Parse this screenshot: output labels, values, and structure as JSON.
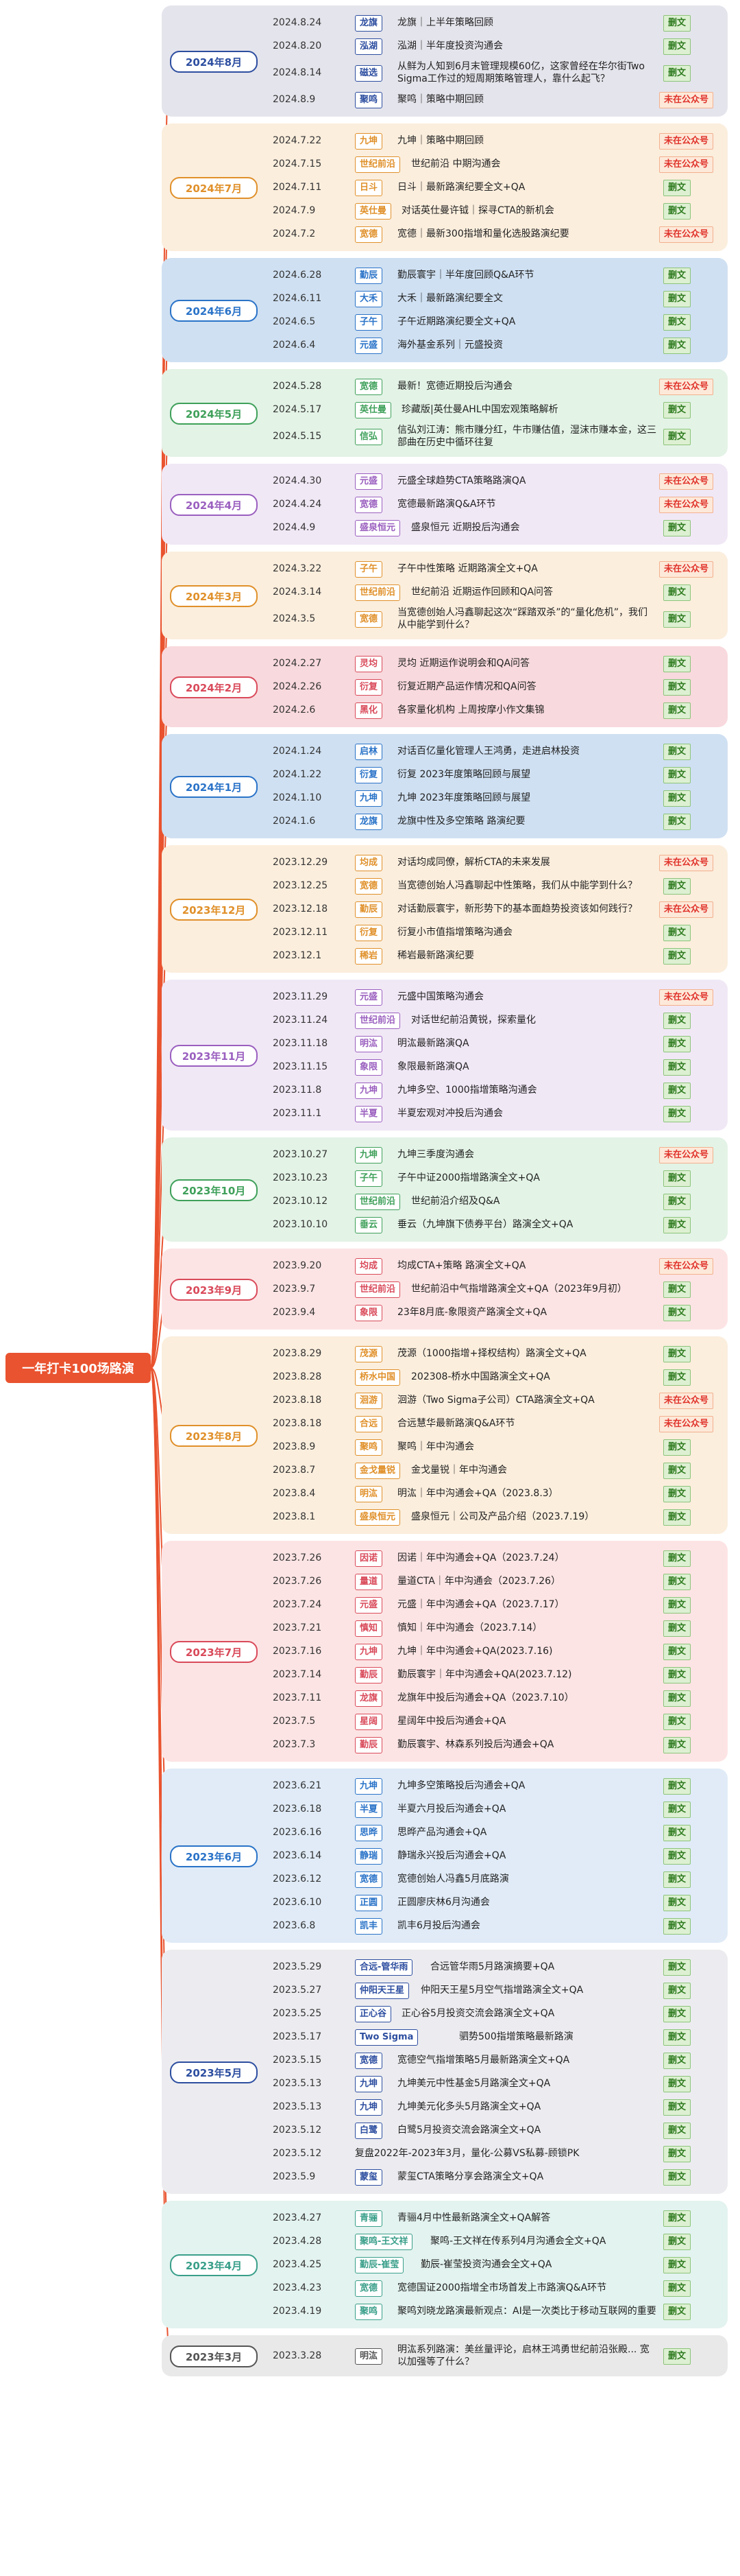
{
  "root": {
    "label": "一年打卡100场路演",
    "color": "#e9532f"
  },
  "badges": {
    "full": "删文",
    "not": "未在公众号"
  },
  "months": [
    {
      "label": "2024年8月",
      "bg": "#e4e4ec",
      "accent": "#2d4ea0",
      "items": [
        {
          "date": "2024.8.24",
          "inst": "龙旗",
          "title": "龙旗｜上半年策略回顾",
          "badge": "full"
        },
        {
          "date": "2024.8.20",
          "inst": "泓湖",
          "title": "泓湖｜半年度投资沟通会",
          "badge": "full"
        },
        {
          "date": "2024.8.14",
          "inst": "磁选",
          "title": "从鲜为人知到6月末管理规模60亿，这家曾经在华尔街Two Sigma工作过的短周期策略管理人，靠什么起飞？",
          "badge": "full"
        },
        {
          "date": "2024.8.9",
          "inst": "聚鸣",
          "title": "聚鸣｜策略中期回顾",
          "badge": "not"
        }
      ]
    },
    {
      "label": "2024年7月",
      "bg": "#fbeedd",
      "accent": "#e0902a",
      "items": [
        {
          "date": "2024.7.22",
          "inst": "九坤",
          "title": "九坤｜策略中期回顾",
          "badge": "not"
        },
        {
          "date": "2024.7.15",
          "inst": "世纪前沿",
          "title": "世纪前沿 中期沟通会",
          "badge": "not"
        },
        {
          "date": "2024.7.11",
          "inst": "日斗",
          "title": "日斗｜最新路演纪要全文+QA",
          "badge": "full"
        },
        {
          "date": "2024.7.9",
          "inst": "英仕曼",
          "title": "对话英仕曼许钺｜探寻CTA的新机会",
          "badge": "full"
        },
        {
          "date": "2024.7.2",
          "inst": "宽德",
          "title": "宽德｜最新300指增和量化选股路演纪要",
          "badge": "not"
        }
      ]
    },
    {
      "label": "2024年6月",
      "bg": "#cfe0f2",
      "accent": "#2a73c8",
      "items": [
        {
          "date": "2024.6.28",
          "inst": "勤辰",
          "title": "勤辰寰宇｜半年度回顾Q&A环节",
          "badge": "full"
        },
        {
          "date": "2024.6.11",
          "inst": "大禾",
          "title": "大禾｜最新路演纪要全文",
          "badge": "full"
        },
        {
          "date": "2024.6.5",
          "inst": "子午",
          "title": "子午近期路演纪要全文+QA",
          "badge": "full"
        },
        {
          "date": "2024.6.4",
          "inst": "元盛",
          "title": "海外基金系列｜元盛投资",
          "badge": "full"
        }
      ]
    },
    {
      "label": "2024年5月",
      "bg": "#e3f3e6",
      "accent": "#3fa05a",
      "items": [
        {
          "date": "2024.5.28",
          "inst": "宽德",
          "title": "最新！宽德近期投后沟通会",
          "badge": "not"
        },
        {
          "date": "2024.5.17",
          "inst": "英仕曼",
          "title": "珍藏版|英仕曼AHL中国宏观策略解析",
          "badge": "full"
        },
        {
          "date": "2024.5.15",
          "inst": "信弘",
          "title": "信弘刘江涛：熊市赚分红，牛市赚估值，湿沫市赚本金，这三部曲在历史中循环往复",
          "badge": "full"
        }
      ]
    },
    {
      "label": "2024年4月",
      "bg": "#f1e8f6",
      "accent": "#9a5fbf",
      "items": [
        {
          "date": "2024.4.30",
          "inst": "元盛",
          "title": "元盛全球趋势CTA策略路演QA",
          "badge": "not"
        },
        {
          "date": "2024.4.24",
          "inst": "宽德",
          "title": "宽德最新路演Q&A环节",
          "badge": "not"
        },
        {
          "date": "2024.4.9",
          "inst": "盛泉恒元",
          "title": "盛泉恒元 近期投后沟通会",
          "badge": "full"
        }
      ]
    },
    {
      "label": "2024年3月",
      "bg": "#fbeedd",
      "accent": "#e0902a",
      "items": [
        {
          "date": "2024.3.22",
          "inst": "子午",
          "title": "子午中性策略 近期路演全文+QA",
          "badge": "not"
        },
        {
          "date": "2024.3.14",
          "inst": "世纪前沿",
          "title": "世纪前沿 近期运作回顾和QA问答",
          "badge": "full"
        },
        {
          "date": "2024.3.5",
          "inst": "宽德",
          "title": "当宽德创始人冯鑫聊起这次“踩踏双杀”的“量化危机”，我们从中能学到什么？",
          "badge": "full"
        }
      ]
    },
    {
      "label": "2024年2月",
      "bg": "#f8d9dd",
      "accent": "#d94a5a",
      "items": [
        {
          "date": "2024.2.27",
          "inst": "灵均",
          "title": "灵均 近期运作说明会和QA问答",
          "badge": "full"
        },
        {
          "date": "2024.2.26",
          "inst": "衍复",
          "title": "衍复近期产品运作情况和QA问答",
          "badge": "full"
        },
        {
          "date": "2024.2.6",
          "inst": "黑化",
          "title": "各家量化机构 上周按摩小作文集锦",
          "badge": "full"
        }
      ]
    },
    {
      "label": "2024年1月",
      "bg": "#cfe0f2",
      "accent": "#2a73c8",
      "items": [
        {
          "date": "2024.1.24",
          "inst": "启林",
          "title": "对话百亿量化管理人王鸿勇，走进启林投资",
          "badge": "full"
        },
        {
          "date": "2024.1.22",
          "inst": "衍复",
          "title": "衍复 2023年度策略回顾与展望",
          "badge": "full"
        },
        {
          "date": "2024.1.10",
          "inst": "九坤",
          "title": "九坤 2023年度策略回顾与展望",
          "badge": "full"
        },
        {
          "date": "2024.1.6",
          "inst": "龙旗",
          "title": "龙旗中性及多空策略 路演纪要",
          "badge": "full"
        }
      ]
    },
    {
      "label": "2023年12月",
      "bg": "#fbeedd",
      "accent": "#e0902a",
      "items": [
        {
          "date": "2023.12.29",
          "inst": "均成",
          "title": "对话均成同僚，解析CTA的未来发展",
          "badge": "not"
        },
        {
          "date": "2023.12.25",
          "inst": "宽德",
          "title": "当宽德创始人冯鑫聊起中性策略，我们从中能学到什么？",
          "badge": "full"
        },
        {
          "date": "2023.12.18",
          "inst": "勤辰",
          "title": "对话勤辰寰宇，新形势下的基本面趋势投资该如何践行？",
          "badge": "not"
        },
        {
          "date": "2023.12.11",
          "inst": "衍复",
          "title": "衍复小市值指增策略沟通会",
          "badge": "full"
        },
        {
          "date": "2023.12.1",
          "inst": "稀岩",
          "title": "稀岩最新路演纪要",
          "badge": "full"
        }
      ]
    },
    {
      "label": "2023年11月",
      "bg": "#f1e8f6",
      "accent": "#9a5fbf",
      "items": [
        {
          "date": "2023.11.29",
          "inst": "元盛",
          "title": "元盛中国策略沟通会",
          "badge": "not"
        },
        {
          "date": "2023.11.24",
          "inst": "世纪前沿",
          "title": "对话世纪前沿黄锐，探索量化",
          "badge": "full"
        },
        {
          "date": "2023.11.18",
          "inst": "明汯",
          "title": "明汯最新路演QA",
          "badge": "full"
        },
        {
          "date": "2023.11.15",
          "inst": "象限",
          "title": "象限最新路演QA",
          "badge": "full"
        },
        {
          "date": "2023.11.8",
          "inst": "九坤",
          "title": "九坤多空、1000指增策略沟通会",
          "badge": "full"
        },
        {
          "date": "2023.11.1",
          "inst": "半夏",
          "title": "半夏宏观对冲投后沟通会",
          "badge": "full"
        }
      ]
    },
    {
      "label": "2023年10月",
      "bg": "#e3f3e6",
      "accent": "#3fa05a",
      "items": [
        {
          "date": "2023.10.27",
          "inst": "九坤",
          "title": "九坤三季度沟通会",
          "badge": "not"
        },
        {
          "date": "2023.10.23",
          "inst": "子午",
          "title": "子午中证2000指增路演全文+QA",
          "badge": "full"
        },
        {
          "date": "2023.10.12",
          "inst": "世纪前沿",
          "title": "世纪前沿介绍及Q&A",
          "badge": "full"
        },
        {
          "date": "2023.10.10",
          "inst": "垂云",
          "title": "垂云（九坤旗下债券平台）路演全文+QA",
          "badge": "full"
        }
      ]
    },
    {
      "label": "2023年9月",
      "bg": "#fde4e4",
      "accent": "#d94a5a",
      "items": [
        {
          "date": "2023.9.20",
          "inst": "均成",
          "title": "均成CTA+策略 路演全文+QA",
          "badge": "not"
        },
        {
          "date": "2023.9.7",
          "inst": "世纪前沿",
          "title": "世纪前沿中气指增路演全文+QA（2023年9月初）",
          "badge": "full"
        },
        {
          "date": "2023.9.4",
          "inst": "象限",
          "title": "23年8月底-象限资产路演全文+QA",
          "badge": "full"
        }
      ]
    },
    {
      "label": "2023年8月",
      "bg": "#fbeedd",
      "accent": "#e0902a",
      "items": [
        {
          "date": "2023.8.29",
          "inst": "茂源",
          "title": "茂源（1000指增+择权结构）路演全文+QA",
          "badge": "full"
        },
        {
          "date": "2023.8.28",
          "inst": "桥水中国",
          "title": "202308-桥水中国路演全文+QA",
          "badge": "full"
        },
        {
          "date": "2023.8.18",
          "inst": "洄游",
          "title": "洄游（Two Sigma子公司）CTA路演全文+QA",
          "badge": "not"
        },
        {
          "date": "2023.8.18",
          "inst": "合远",
          "title": "合远慧华最新路演Q&A环节",
          "badge": "not"
        },
        {
          "date": "2023.8.9",
          "inst": "聚鸣",
          "title": "聚鸣｜年中沟通会",
          "badge": "full"
        },
        {
          "date": "2023.8.7",
          "inst": "金戈量锐",
          "title": "金戈量锐｜年中沟通会",
          "badge": "full"
        },
        {
          "date": "2023.8.4",
          "inst": "明汯",
          "title": "明汯｜年中沟通会+QA（2023.8.3）",
          "badge": "full"
        },
        {
          "date": "2023.8.1",
          "inst": "盛泉恒元",
          "title": "盛泉恒元｜公司及产品介绍（2023.7.19）",
          "badge": "full"
        }
      ]
    },
    {
      "label": "2023年7月",
      "bg": "#fde4e4",
      "accent": "#d94a5a",
      "items": [
        {
          "date": "2023.7.26",
          "inst": "因诺",
          "title": "因诺｜年中沟通会+QA（2023.7.24）",
          "badge": "full"
        },
        {
          "date": "2023.7.26",
          "inst": "量道",
          "title": "量道CTA｜年中沟通会（2023.7.26）",
          "badge": "full"
        },
        {
          "date": "2023.7.24",
          "inst": "元盛",
          "title": "元盛｜年中沟通会+QA（2023.7.17）",
          "badge": "full"
        },
        {
          "date": "2023.7.21",
          "inst": "慎知",
          "title": "慎知｜年中沟通会（2023.7.14）",
          "badge": "full"
        },
        {
          "date": "2023.7.16",
          "inst": "九坤",
          "title": "九坤｜年中沟通会+QA(2023.7.16)",
          "badge": "full"
        },
        {
          "date": "2023.7.14",
          "inst": "勤辰",
          "title": "勤辰寰宇｜年中沟通会+QA(2023.7.12)",
          "badge": "full"
        },
        {
          "date": "2023.7.11",
          "inst": "龙旗",
          "title": "龙旗年中投后沟通会+QA（2023.7.10）",
          "badge": "full"
        },
        {
          "date": "2023.7.5",
          "inst": "星阔",
          "title": "星阔年中投后沟通会+QA",
          "badge": "full"
        },
        {
          "date": "2023.7.3",
          "inst": "勤辰",
          "title": "勤辰寰宇、林森系列投后沟通会+QA",
          "badge": "full"
        }
      ]
    },
    {
      "label": "2023年6月",
      "bg": "#e0ebf7",
      "accent": "#2a73c8",
      "items": [
        {
          "date": "2023.6.21",
          "inst": "九坤",
          "title": "九坤多空策略投后沟通会+QA",
          "badge": "full"
        },
        {
          "date": "2023.6.18",
          "inst": "半夏",
          "title": "半夏六月投后沟通会+QA",
          "badge": "full"
        },
        {
          "date": "2023.6.16",
          "inst": "思晔",
          "title": "思晔产品沟通会+QA",
          "badge": "full"
        },
        {
          "date": "2023.6.14",
          "inst": "静瑞",
          "title": "静瑞永兴投后沟通会+QA",
          "badge": "full"
        },
        {
          "date": "2023.6.12",
          "inst": "宽德",
          "title": "宽德创始人冯鑫5月底路演",
          "badge": "full"
        },
        {
          "date": "2023.6.10",
          "inst": "正圆",
          "title": "正圆廖庆林6月沟通会",
          "badge": "full"
        },
        {
          "date": "2023.6.8",
          "inst": "凯丰",
          "title": "凯丰6月投后沟通会",
          "badge": "full"
        }
      ]
    },
    {
      "label": "2023年5月",
      "bg": "#ececf0",
      "accent": "#2d4ea0",
      "items": [
        {
          "date": "2023.5.29",
          "inst": "合远-管华雨",
          "title": "合远管华雨5月路演摘要+QA",
          "badge": "full"
        },
        {
          "date": "2023.5.27",
          "inst": "仲阳天王星",
          "title": "仲阳天王星5月空气指增路演全文+QA",
          "badge": "full"
        },
        {
          "date": "2023.5.25",
          "inst": "正心谷",
          "title": "正心谷5月投资交流会路演全文+QA",
          "badge": "full"
        },
        {
          "date": "2023.5.17",
          "inst": "Two Sigma",
          "title": "驷势500指增策略最新路演",
          "badge": "full"
        },
        {
          "date": "2023.5.15",
          "inst": "宽德",
          "title": "宽德空气指增策略5月最新路演全文+QA",
          "badge": "full"
        },
        {
          "date": "2023.5.13",
          "inst": "九坤",
          "title": "九坤美元中性基金5月路演全文+QA",
          "badge": "full"
        },
        {
          "date": "2023.5.13",
          "inst": "九坤",
          "title": "九坤美元化多头5月路演全文+QA",
          "badge": "full"
        },
        {
          "date": "2023.5.12",
          "inst": "白鹭",
          "title": "白鹭5月投资交流会路演全文+QA",
          "badge": "full"
        },
        {
          "date": "2023.5.12",
          "inst": "",
          "title": "复盘2022年-2023年3月，量化-公募VS私募-顾锁PK",
          "badge": "full"
        },
        {
          "date": "2023.5.9",
          "inst": "蒙玺",
          "title": "蒙玺CTA策略分享会路演全文+QA",
          "badge": "full"
        }
      ]
    },
    {
      "label": "2023年4月",
      "bg": "#e3f3ef",
      "accent": "#3a9f8a",
      "items": [
        {
          "date": "2023.4.27",
          "inst": "青骊",
          "title": "青骊4月中性最新路演全文+QA解答",
          "badge": "full"
        },
        {
          "date": "2023.4.28",
          "inst": "聚鸣-王文祥",
          "title": "聚鸣-王文祥在传系列4月沟通会全文+QA",
          "badge": "full"
        },
        {
          "date": "2023.4.25",
          "inst": "勤辰-崔莹",
          "title": "勤辰-崔莹投资沟通会全文+QA",
          "badge": "full"
        },
        {
          "date": "2023.4.23",
          "inst": "宽德",
          "title": "宽德国证2000指增全市场首发上市路演Q&A环节",
          "badge": "full"
        },
        {
          "date": "2023.4.19",
          "inst": "聚鸣",
          "title": "聚鸣刘晓龙路演最新观点：AI是一次类比于移动互联网的重要变革",
          "badge": "full"
        }
      ]
    },
    {
      "label": "2023年3月",
      "bg": "#e9e9e9",
      "accent": "#555555",
      "items": [
        {
          "date": "2023.3.28",
          "inst": "明汯",
          "title": "明汯系列路演：美丝量评论，启林王鸿勇世纪前沿张殿... 宽以加强等了什么？",
          "badge": "full"
        }
      ]
    }
  ]
}
